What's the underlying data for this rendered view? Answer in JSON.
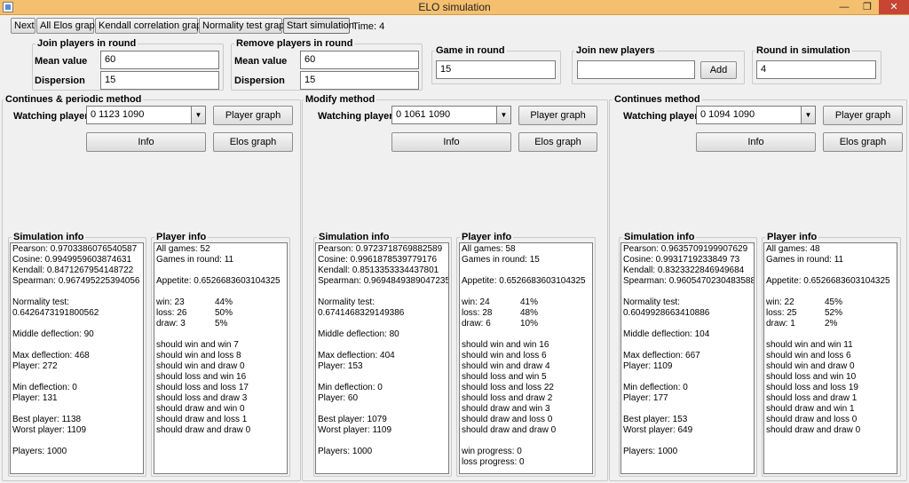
{
  "window": {
    "title": "ELO simulation",
    "min_glyph": "—",
    "max_glyph": "❐",
    "close_glyph": "✕"
  },
  "toolbar": {
    "next": "Next",
    "all_elos_graph": "All Elos graph",
    "kendall_graph": "Kendall correlation graph",
    "normality_graph": "Normality test graph",
    "start_simulation": "Start simulation",
    "time": "Time: 4"
  },
  "join_round": {
    "title": "Join players in round",
    "mean_label": "Mean value",
    "mean_value": "60",
    "dispersion_label": "Dispersion",
    "dispersion_value": "15"
  },
  "remove_round": {
    "title": "Remove players in round",
    "mean_label": "Mean value",
    "mean_value": "60",
    "dispersion_label": "Dispersion",
    "dispersion_value": "15"
  },
  "game_in_round": {
    "title": "Game in round",
    "value": "15"
  },
  "join_new": {
    "title": "Join new players",
    "value": "",
    "add_label": "Add"
  },
  "round_sim": {
    "title": "Round in simulation",
    "value": "4"
  },
  "panels": [
    {
      "title": "Continues & periodic method",
      "watching_label": "Watching player",
      "watching_value": "0 1123 1090",
      "player_graph": "Player graph",
      "info": "Info",
      "elos_graph": "Elos graph",
      "sim_info_title": "Simulation info",
      "player_info_title": "Player info",
      "sim": {
        "pearson": "Pearson: 0.9703386076540587",
        "cosine": "Cosine: 0.9949959603874631",
        "kendall": "Kendall: 0.8471267954148722",
        "spearman": "Spearman: 0.967495225394056",
        "normality_label": "Normality test:",
        "normality_value": "0.6426473191800562",
        "middle": "Middle deflection: 90",
        "max": "Max deflection: 468",
        "max_player": "Player: 272",
        "min": "Min deflection: 0",
        "min_player": "Player: 131",
        "best": "Best player: 1138",
        "worst": "Worst player: 1109",
        "players": "Players: 1000"
      },
      "player": {
        "all_games": "All games: 52",
        "games_round": "Games in round: 11",
        "appetite": "Appetite: 0.6526683603104325",
        "win": "win: 23",
        "win_pct": "44%",
        "loss": "loss: 26",
        "loss_pct": "50%",
        "draw": "draw: 3",
        "draw_pct": "5%",
        "sw_win": "should win and win 7",
        "sw_loss": "should win and loss 8",
        "sw_draw": "should win and draw 0",
        "sl_win": "should loss and win 16",
        "sl_loss": "should loss and loss 17",
        "sl_draw": "should loss and draw 3",
        "sd_win": "should draw and win 0",
        "sd_loss": "should draw and loss 1",
        "sd_draw": "should draw and draw 0",
        "win_progress": "",
        "loss_progress": ""
      }
    },
    {
      "title": "Modify method",
      "watching_label": "Watching player",
      "watching_value": "0 1061 1090",
      "player_graph": "Player graph",
      "info": "Info",
      "elos_graph": "Elos graph",
      "sim_info_title": "Simulation info",
      "player_info_title": "Player info",
      "sim": {
        "pearson": "Pearson: 0.9723718769882589",
        "cosine": "Cosine: 0.9961878539779176",
        "kendall": "Kendall: 0.8513353334437801",
        "spearman": "Spearman: 0.9694849389047235",
        "normality_label": "Normality test:",
        "normality_value": "0.6741468329149386",
        "middle": "Middle deflection: 80",
        "max": "Max deflection: 404",
        "max_player": "Player: 153",
        "min": "Min deflection: 0",
        "min_player": "Player: 60",
        "best": "Best player: 1079",
        "worst": "Worst player: 1109",
        "players": "Players: 1000"
      },
      "player": {
        "all_games": "All games: 58",
        "games_round": "Games in round: 15",
        "appetite": "Appetite: 0.6526683603104325",
        "win": "win: 24",
        "win_pct": "41%",
        "loss": "loss: 28",
        "loss_pct": "48%",
        "draw": "draw: 6",
        "draw_pct": "10%",
        "sw_win": "should win and win 16",
        "sw_loss": "should win and loss 6",
        "sw_draw": "should win and draw 4",
        "sl_win": "should loss and win 5",
        "sl_loss": "should loss and loss 22",
        "sl_draw": "should loss and draw 2",
        "sd_win": "should draw and win 3",
        "sd_loss": "should draw and loss 0",
        "sd_draw": "should draw and draw 0",
        "win_progress": "win progress: 0",
        "loss_progress": "loss progress: 0"
      }
    },
    {
      "title": "Continues method",
      "watching_label": "Watching player",
      "watching_value": "0 1094 1090",
      "player_graph": "Player graph",
      "info": "Info",
      "elos_graph": "Elos graph",
      "sim_info_title": "Simulation info",
      "player_info_title": "Player info",
      "sim": {
        "pearson": "Pearson: 0.9635709199907629",
        "cosine": "Cosine: 0.9931719233849 73",
        "kendall": "Kendall: 0.8323322846949684",
        "spearman": "Spearman: 0.9605470230483588",
        "normality_label": "Normality test:",
        "normality_value": "0.6049928663410886",
        "middle": "Middle deflection: 104",
        "max": "Max deflection: 667",
        "max_player": "Player: 1109",
        "min": "Min deflection: 0",
        "min_player": "Player: 177",
        "best": "Best player: 153",
        "worst": "Worst player: 649",
        "players": "Players: 1000"
      },
      "player": {
        "all_games": "All games: 48",
        "games_round": "Games in round: 11",
        "appetite": "Appetite: 0.6526683603104325",
        "win": "win: 22",
        "win_pct": "45%",
        "loss": "loss: 25",
        "loss_pct": "52%",
        "draw": "draw: 1",
        "draw_pct": "2%",
        "sw_win": "should win and win 11",
        "sw_loss": "should win and loss 6",
        "sw_draw": "should win and draw 0",
        "sl_win": "should loss and win 10",
        "sl_loss": "should loss and loss 19",
        "sl_draw": "should loss and draw 1",
        "sd_win": "should draw and win 1",
        "sd_loss": "should draw and loss 0",
        "sd_draw": "should draw and draw 0",
        "win_progress": "",
        "loss_progress": ""
      }
    }
  ]
}
